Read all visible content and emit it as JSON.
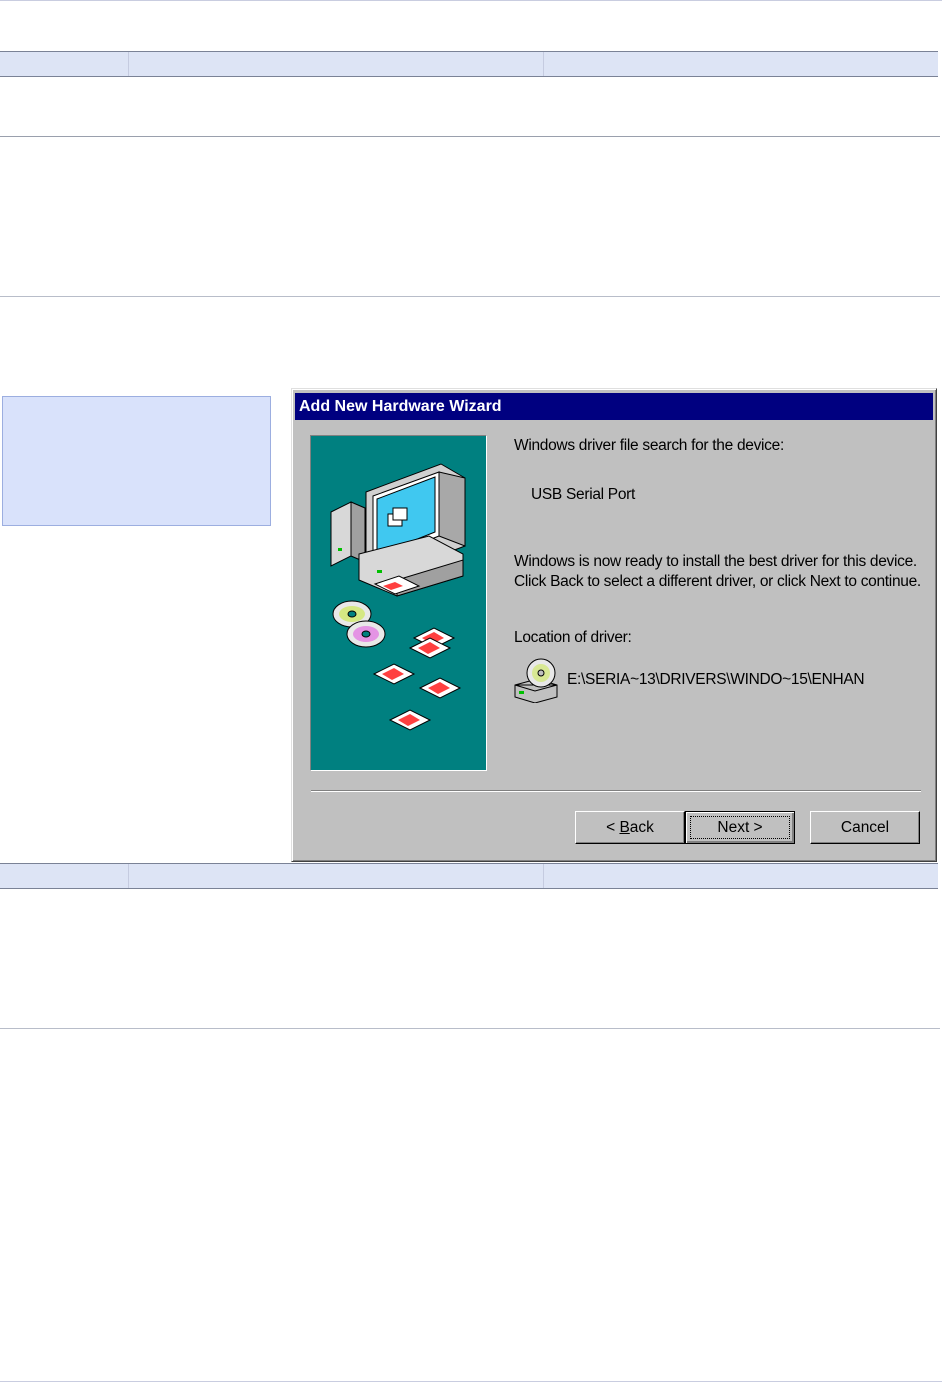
{
  "wizard": {
    "title": "Add New Hardware Wizard",
    "search_heading": "Windows driver file search for the device:",
    "device_name": "USB Serial Port",
    "ready_message": "Windows is now ready to install the best driver for this device. Click Back to select a different driver, or click Next to continue.",
    "location_label": "Location of driver:",
    "driver_path": "E:\\SERIA~13\\DRIVERS\\WINDO~15\\ENHAN",
    "buttons": {
      "back_prefix": "< ",
      "back_mnemonic": "B",
      "back_rest": "ack",
      "next": "Next >",
      "cancel": "Cancel"
    }
  },
  "colors": {
    "title_bar": "#000080",
    "dialog_face": "#c0c0c0",
    "art_background": "#008080",
    "note_box": "#d9e2fb",
    "table_header": "#dde4f5"
  },
  "icons": [
    "computer-illustration-icon",
    "cd-disc-icon",
    "floppy-disk-icon",
    "cd-drive-icon"
  ]
}
